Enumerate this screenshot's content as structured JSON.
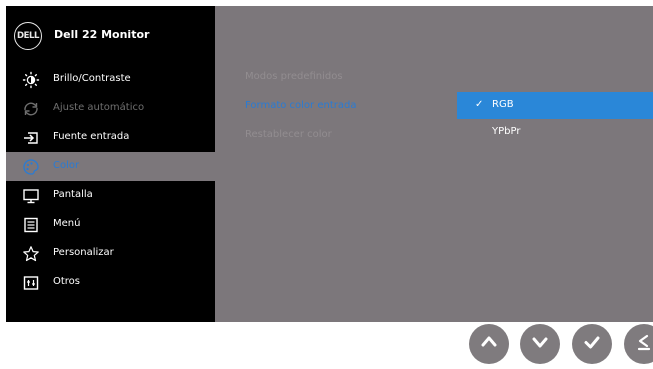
{
  "brand": {
    "logo_text": "DELL",
    "title": "Dell 22 Monitor"
  },
  "menu": {
    "items": [
      {
        "label": "Brillo/Contraste",
        "icon": "brightness-icon"
      },
      {
        "label": "Ajuste automático",
        "icon": "auto-adjust-icon"
      },
      {
        "label": "Fuente entrada",
        "icon": "input-source-icon"
      },
      {
        "label": "Color",
        "icon": "color-palette-icon"
      },
      {
        "label": "Pantalla",
        "icon": "display-icon"
      },
      {
        "label": "Menú",
        "icon": "menu-icon"
      },
      {
        "label": "Personalizar",
        "icon": "star-icon"
      },
      {
        "label": "Otros",
        "icon": "others-icon"
      }
    ],
    "active": "Color"
  },
  "submenu": {
    "items": [
      {
        "label": "Modos predefinidos"
      },
      {
        "label": "Formato color entrada"
      },
      {
        "label": "Restablecer color"
      }
    ],
    "active": "Formato color entrada"
  },
  "options": {
    "items": [
      {
        "label": "RGB",
        "check": "✓"
      },
      {
        "label": "YPbPr",
        "check": ""
      }
    ],
    "selected": "RGB"
  },
  "buttons": [
    {
      "icon": "up-arrow-icon"
    },
    {
      "icon": "down-arrow-icon"
    },
    {
      "icon": "check-icon"
    },
    {
      "icon": "back-icon"
    }
  ],
  "colors": {
    "sidebar_bg": "#000000",
    "panel_bg": "#7c777b",
    "accent_blue": "#2a87d8",
    "dim_text": "#6f6f6f"
  }
}
